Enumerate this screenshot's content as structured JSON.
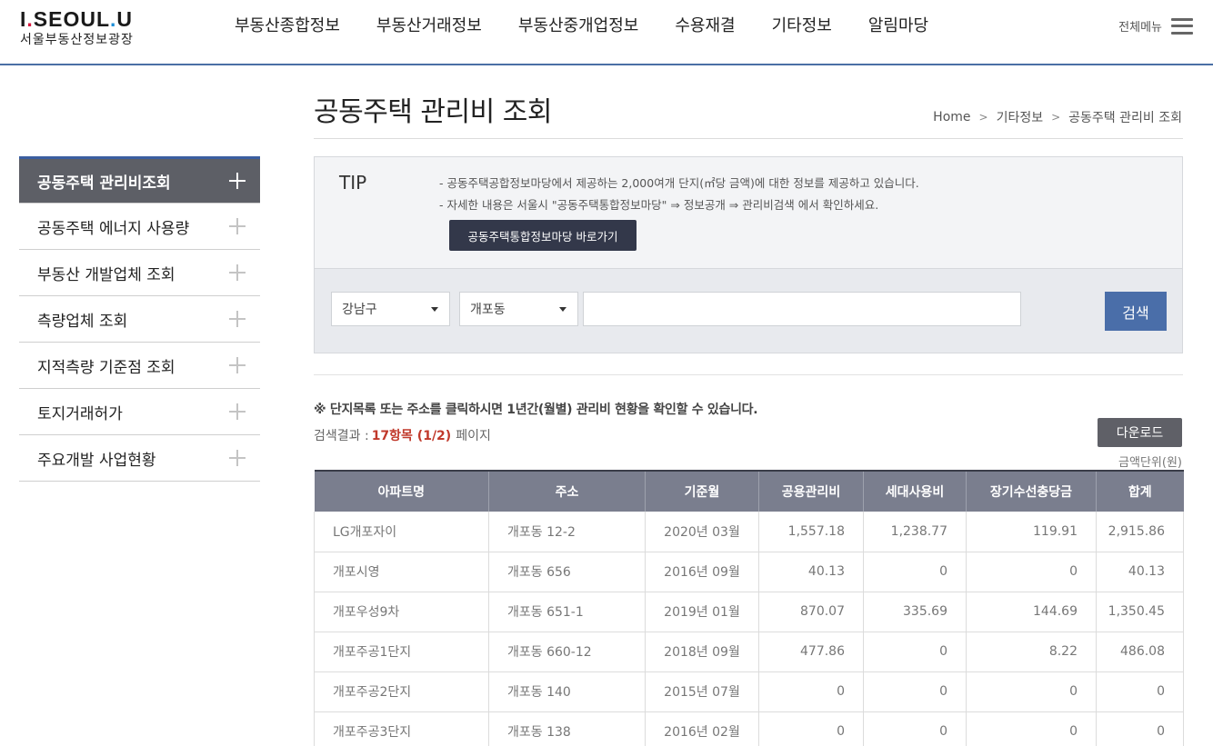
{
  "logo": {
    "part1": "I",
    "dot": ".",
    "part2": "SE",
    "part3": "O",
    "part4": "UL",
    "dot2": ".",
    "part5": "U",
    "subtitle": "서울부동산정보광장"
  },
  "gnb": [
    "부동산종합정보",
    "부동산거래정보",
    "부동산중개업정보",
    "수용재결",
    "기타정보",
    "알림마당"
  ],
  "all_menu": "전체메뉴",
  "sidebar": [
    {
      "label": "공동주택 관리비조회",
      "active": true
    },
    {
      "label": "공동주택 에너지 사용량",
      "active": false
    },
    {
      "label": "부동산 개발업체 조회",
      "active": false
    },
    {
      "label": "측량업체 조회",
      "active": false
    },
    {
      "label": "지적측량 기준점 조회",
      "active": false
    },
    {
      "label": "토지거래허가",
      "active": false
    },
    {
      "label": "주요개발 사업현황",
      "active": false
    }
  ],
  "page": {
    "title": "공동주택 관리비 조회",
    "breadcrumb": [
      "Home",
      "기타정보",
      "공동주택 관리비 조회"
    ]
  },
  "tip": {
    "label": "TIP",
    "line1": "-  공동주택공합정보마당에서 제공하는 2,000여개 단지(㎡당 금액)에 대한 정보를 제공하고 있습니다.",
    "line2": "-  자세한 내용은 서울시 \"공동주택통합정보마당\" ⇒ 정보공개 ⇒ 관리비검색 에서 확인하세요.",
    "button": "공동주택통합정보마당 바로가기"
  },
  "search": {
    "gu": "강남구",
    "dong": "개포동",
    "input_value": "",
    "button": "검색"
  },
  "notice": "※ 단지목록 또는 주소를 클릭하시면 1년간(월별) 관리비 현황을 확인할 수 있습니다.",
  "result": {
    "prefix": "검색결과 :",
    "count": "17항목 (1/2)",
    "suffix": "페이지"
  },
  "download": "다운로드",
  "unit": "금액단위(원)",
  "table": {
    "headers": [
      "아파트명",
      "주소",
      "기준월",
      "공용관리비",
      "세대사용비",
      "장기수선충당금",
      "합계"
    ],
    "rows": [
      [
        "LG개포자이",
        "개포동 12-2",
        "2020년 03월",
        "1,557.18",
        "1,238.77",
        "119.91",
        "2,915.86"
      ],
      [
        "개포시영",
        "개포동 656",
        "2016년 09월",
        "40.13",
        "0",
        "0",
        "40.13"
      ],
      [
        "개포우성9차",
        "개포동 651-1",
        "2019년 01월",
        "870.07",
        "335.69",
        "144.69",
        "1,350.45"
      ],
      [
        "개포주공1단지",
        "개포동 660-12",
        "2018년 09월",
        "477.86",
        "0",
        "8.22",
        "486.08"
      ],
      [
        "개포주공2단지",
        "개포동 140",
        "2015년 07월",
        "0",
        "0",
        "0",
        "0"
      ],
      [
        "개포주공3단지",
        "개포동 138",
        "2016년 02월",
        "0",
        "0",
        "0",
        "0"
      ]
    ]
  },
  "colors": {
    "accent": "#4a6ea9",
    "header_line": "#4a6fa5",
    "active_menu": "#5d5f66",
    "table_head": "#7a7e8e",
    "highlight": "#c0392b"
  }
}
